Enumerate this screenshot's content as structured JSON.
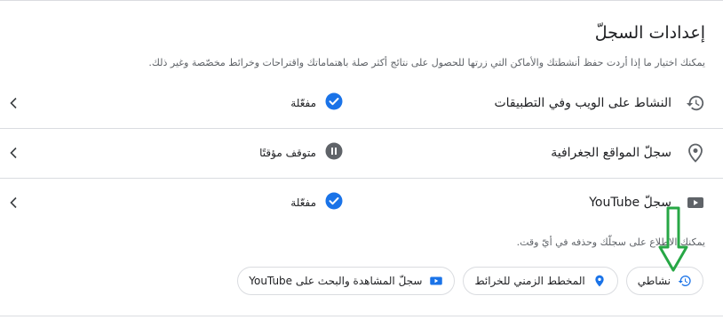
{
  "header": {
    "title": "إعدادات السجلّ",
    "description": "يمكنك اختيار ما إذا أردت حفظ أنشطتك والأماكن التي زرتها للحصول على نتائج أكثر صلة باهتماماتك واقتراحات وخرائط مخصّصة وغير ذلك."
  },
  "rows": [
    {
      "label": "النشاط على الويب وفي التطبيقات",
      "icon": "history-icon",
      "status": "مفعّلة",
      "status_icon": "check-circle-icon"
    },
    {
      "label": "سجلّ المواقع الجغرافية",
      "icon": "location-pin-icon",
      "status": "متوقف مؤقتًا",
      "status_icon": "pause-circle-icon"
    },
    {
      "label": "سجلّ YouTube",
      "icon": "youtube-icon",
      "status": "مفعّلة",
      "status_icon": "check-circle-icon"
    }
  ],
  "sub_description": "يمكنك الاطلاع على سجلّك وحذفه في أيّ وقت.",
  "chips": [
    {
      "label": "نشاطي",
      "icon": "history-icon"
    },
    {
      "label": "المخطط الزمني للخرائط",
      "icon": "location-pin-icon"
    },
    {
      "label": "سجلّ المشاهدة والبحث على YouTube",
      "icon": "youtube-icon"
    }
  ],
  "colors": {
    "accent": "#1a73e8",
    "paused": "#5f6368",
    "arrow": "#27a745",
    "divider": "#dadce0"
  }
}
